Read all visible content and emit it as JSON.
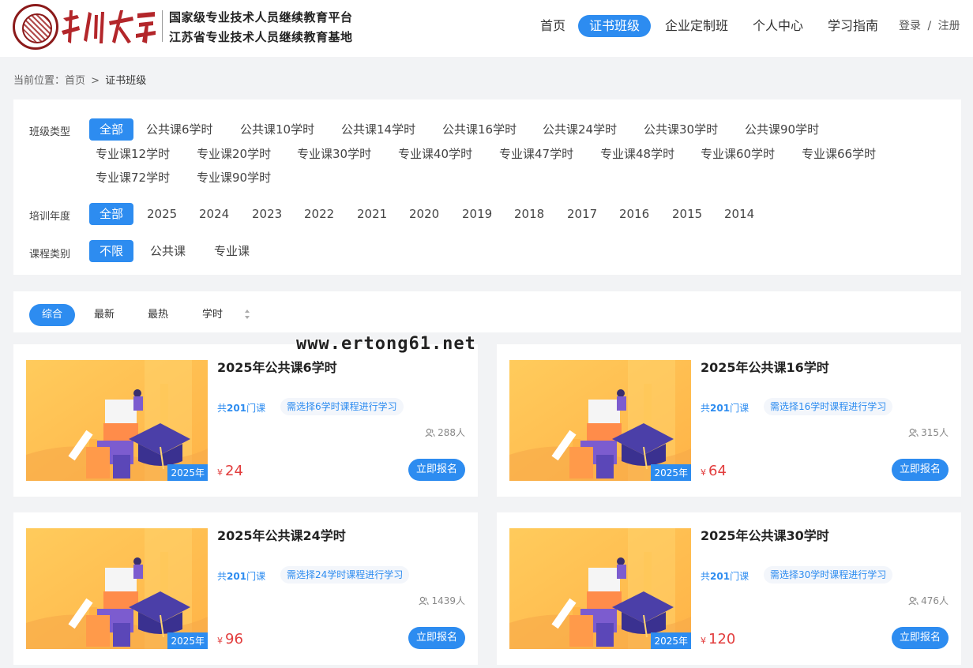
{
  "header": {
    "title_line1": "国家级专业技术人员继续教育平台",
    "title_line2": "江苏省专业技术人员继续教育基地",
    "nav": [
      "首页",
      "证书班级",
      "企业定制班",
      "个人中心",
      "学习指南"
    ],
    "active_nav": "证书班级",
    "login": "登录",
    "separator": "/",
    "register": "注册",
    "brand_color": "#8b1a1a",
    "accent_color": "#2d8cf0"
  },
  "breadcrumb": {
    "prefix": "当前位置：",
    "home": "首页",
    "sep": ">",
    "current": "证书班级"
  },
  "filters": {
    "class_type": {
      "label": "班级类型",
      "options": [
        "全部",
        "公共课6学时",
        "公共课10学时",
        "公共课14学时",
        "公共课16学时",
        "公共课24学时",
        "公共课30学时",
        "公共课90学时",
        "专业课12学时",
        "专业课20学时",
        "专业课30学时",
        "专业课40学时",
        "专业课47学时",
        "专业课48学时",
        "专业课60学时",
        "专业课66学时",
        "专业课72学时",
        "专业课90学时"
      ],
      "selected": "全部"
    },
    "year": {
      "label": "培训年度",
      "options": [
        "全部",
        "2025",
        "2024",
        "2023",
        "2022",
        "2021",
        "2020",
        "2019",
        "2018",
        "2017",
        "2016",
        "2015",
        "2014"
      ],
      "selected": "全部"
    },
    "category": {
      "label": "课程类别",
      "options": [
        "不限",
        "公共课",
        "专业课"
      ],
      "selected": "不限"
    }
  },
  "sort": {
    "options": [
      "综合",
      "最新",
      "最热",
      "学时"
    ],
    "selected": "综合"
  },
  "cards": [
    {
      "title": "2025年公共课6学时",
      "count_prefix": "共",
      "count": "201",
      "count_suffix": "门课",
      "requirement": "需选择6学时课程进行学习",
      "enrolled": "288人",
      "price_symbol": "¥",
      "price": "24",
      "year_tag": "2025年",
      "button": "立即报名"
    },
    {
      "title": "2025年公共课16学时",
      "count_prefix": "共",
      "count": "201",
      "count_suffix": "门课",
      "requirement": "需选择16学时课程进行学习",
      "enrolled": "315人",
      "price_symbol": "¥",
      "price": "64",
      "year_tag": "2025年",
      "button": "立即报名"
    },
    {
      "title": "2025年公共课24学时",
      "count_prefix": "共",
      "count": "201",
      "count_suffix": "门课",
      "requirement": "需选择24学时课程进行学习",
      "enrolled": "1439人",
      "price_symbol": "¥",
      "price": "96",
      "year_tag": "2025年",
      "button": "立即报名"
    },
    {
      "title": "2025年公共课30学时",
      "count_prefix": "共",
      "count": "201",
      "count_suffix": "门课",
      "requirement": "需选择30学时课程进行学习",
      "enrolled": "476人",
      "price_symbol": "¥",
      "price": "120",
      "year_tag": "2025年",
      "button": "立即报名"
    }
  ],
  "watermark": "www.ertong61.net"
}
